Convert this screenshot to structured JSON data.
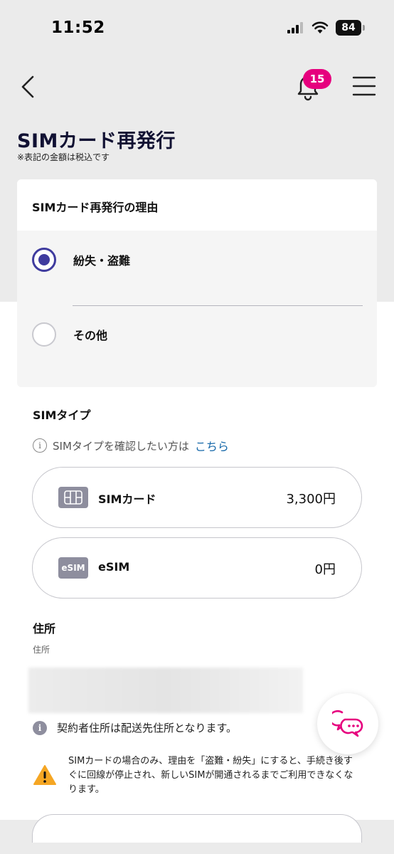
{
  "status_bar": {
    "time": "11:52",
    "battery": "84"
  },
  "header": {
    "notification_count": "15"
  },
  "page": {
    "title": "SIMカード再発行",
    "note": "※表記の金額は税込です"
  },
  "reason": {
    "heading": "SIMカード再発行の理由",
    "options": [
      {
        "label": "紛失・盗難",
        "selected": true
      },
      {
        "label": "その他",
        "selected": false
      }
    ]
  },
  "sim_type": {
    "heading": "SIMタイプ",
    "info_text": "SIMタイプを確認したい方は",
    "info_link": "こちら",
    "options": [
      {
        "name": "SIMカード",
        "price": "3,300円"
      },
      {
        "name": "eSIM",
        "icon_text": "eSIM",
        "price": "0円"
      }
    ]
  },
  "address": {
    "heading": "住所",
    "sub_label": "住所",
    "note": "契約者住所は配送先住所となります。",
    "warning": "SIMカードの場合のみ、理由を「盗難・紛失」にすると、手続き後すぐに回線が停止され、新しいSIMが開通されるまでご利用できなくなります。"
  },
  "colors": {
    "accent": "#e6007e",
    "radio": "#3f3b9e",
    "link": "#1769aa",
    "warning": "#f5a623"
  }
}
